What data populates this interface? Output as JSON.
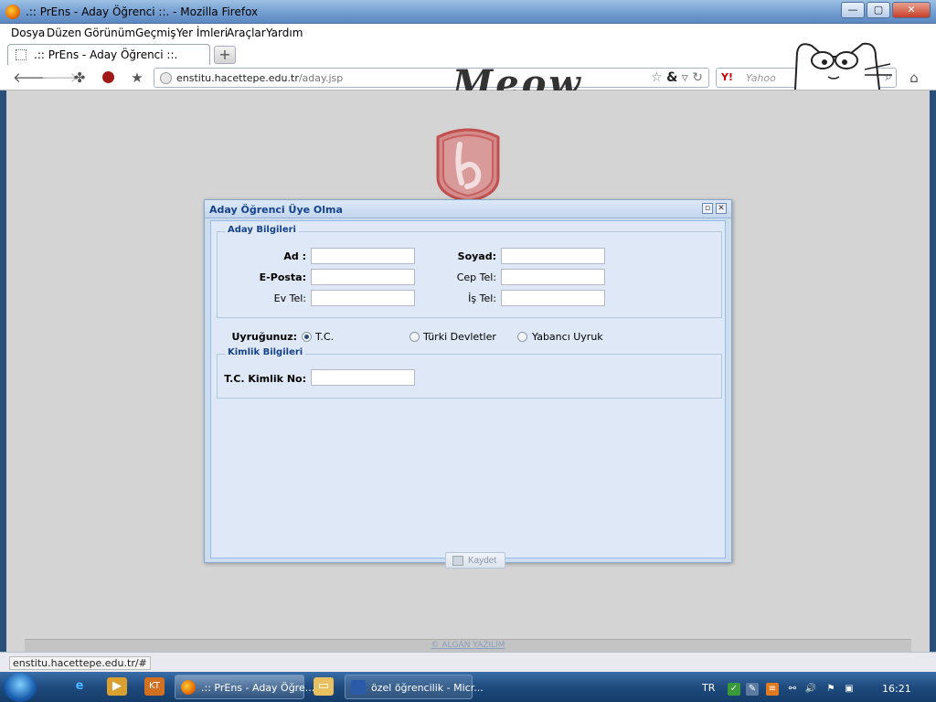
{
  "window": {
    "title": ".:: PrEns - Aday Öğrenci ::. - Mozilla Firefox",
    "buttons": {
      "minimize": "—",
      "maximize": "▢",
      "close": "✕"
    }
  },
  "menu": [
    "Dosya",
    "Düzen",
    "Görünüm",
    "Geçmiş",
    "Yer İmleri",
    "Araçlar",
    "Yardım"
  ],
  "tab": {
    "label": ".:: PrEns - Aday Öğrenci ::.",
    "new_tab": "+"
  },
  "nav": {
    "url_domain": "enstitu.hacettepe.edu.tr",
    "url_path": "/aday.jsp",
    "search_placeholder": "Yahoo",
    "search_engine": "Y!",
    "persona_text": "Meow"
  },
  "dialog": {
    "title": "Aday Öğrenci Üye Olma",
    "group_candidate": "Aday Bilgileri",
    "fields": {
      "ad": {
        "label": "Ad :",
        "value": ""
      },
      "soyad": {
        "label": "Soyad:",
        "value": ""
      },
      "eposta": {
        "label": "E-Posta:",
        "value": ""
      },
      "cep_tel": {
        "label": "Cep Tel:",
        "value": ""
      },
      "ev_tel": {
        "label": "Ev Tel:",
        "value": ""
      },
      "is_tel": {
        "label": "İş Tel:",
        "value": ""
      }
    },
    "nationality": {
      "label": "Uyruğunuz:",
      "options": [
        "T.C.",
        "Türki Devletler",
        "Yabancı Uyruk"
      ],
      "selected": "T.C."
    },
    "group_identity": "Kimlik Bilgileri",
    "tc_kimlik": {
      "label": "T.C. Kimlik No:",
      "value": ""
    },
    "save_label": "Kaydet"
  },
  "footer": "© ALGAN YAZILIM",
  "status_text": "enstitu.hacettepe.edu.tr/#",
  "taskbar": {
    "tasks": [
      ".:: PrEns - Aday Öğre...",
      "özel öğrencilik - Micr..."
    ],
    "lang": "TR",
    "clock": "16:21"
  },
  "colors": {
    "dialog_title": "#15428b",
    "page_bg": "#d4d4d4",
    "logo": "#c94040"
  }
}
